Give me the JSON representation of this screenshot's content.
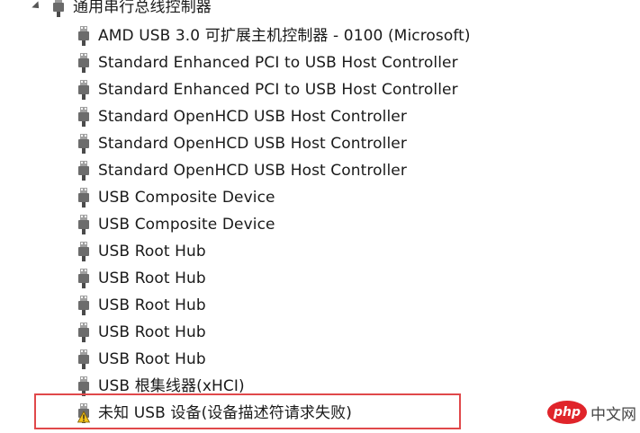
{
  "category": {
    "label": "通用串行总线控制器",
    "icon": "usb-plug-icon",
    "expanded": true
  },
  "devices": [
    {
      "label": "AMD USB 3.0 可扩展主机控制器 - 0100 (Microsoft)",
      "icon": "usb-plug-icon",
      "warning": false
    },
    {
      "label": "Standard Enhanced PCI to USB Host Controller",
      "icon": "usb-plug-icon",
      "warning": false
    },
    {
      "label": "Standard Enhanced PCI to USB Host Controller",
      "icon": "usb-plug-icon",
      "warning": false
    },
    {
      "label": "Standard OpenHCD USB Host Controller",
      "icon": "usb-plug-icon",
      "warning": false
    },
    {
      "label": "Standard OpenHCD USB Host Controller",
      "icon": "usb-plug-icon",
      "warning": false
    },
    {
      "label": "Standard OpenHCD USB Host Controller",
      "icon": "usb-plug-icon",
      "warning": false
    },
    {
      "label": "USB Composite Device",
      "icon": "usb-plug-icon",
      "warning": false
    },
    {
      "label": "USB Composite Device",
      "icon": "usb-plug-icon",
      "warning": false
    },
    {
      "label": "USB Root Hub",
      "icon": "usb-plug-icon",
      "warning": false
    },
    {
      "label": "USB Root Hub",
      "icon": "usb-plug-icon",
      "warning": false
    },
    {
      "label": "USB Root Hub",
      "icon": "usb-plug-icon",
      "warning": false
    },
    {
      "label": "USB Root Hub",
      "icon": "usb-plug-icon",
      "warning": false
    },
    {
      "label": "USB Root Hub",
      "icon": "usb-plug-icon",
      "warning": false
    },
    {
      "label": "USB 根集线器(xHCI)",
      "icon": "usb-plug-icon",
      "warning": false
    },
    {
      "label": "未知 USB 设备(设备描述符请求失败)",
      "icon": "warning-usb-icon",
      "warning": true
    }
  ],
  "highlight_color": "#e0484a",
  "watermark": {
    "logo_text": "php",
    "site_text": "中文网",
    "logo_color": "#e0242a"
  }
}
